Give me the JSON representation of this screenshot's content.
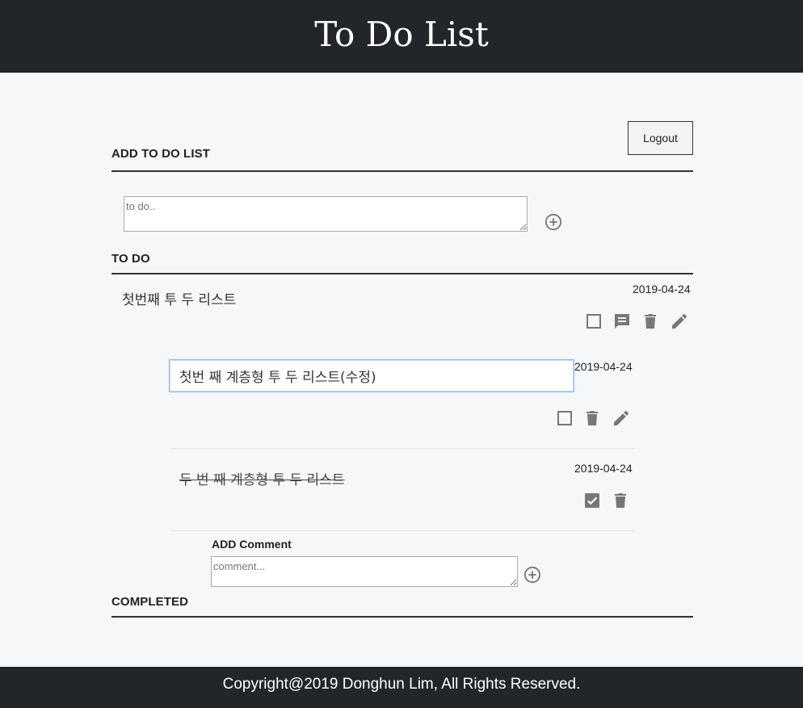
{
  "header": {
    "title": "To Do List"
  },
  "auth": {
    "logout_label": "Logout"
  },
  "add_section": {
    "title": "ADD TO DO LIST",
    "placeholder": "to do.."
  },
  "todo_section": {
    "title": "TO DO",
    "items": [
      {
        "text": "첫번째 투 두 리스트",
        "date": "2019-04-24",
        "completed": false,
        "children": [
          {
            "text": "첫번 째 계층형 투 두 리스트(수정)",
            "date": "2019-04-24",
            "completed": false,
            "editing": true
          },
          {
            "text": "두 번 째 계층형 투 두 리스트",
            "date": "2019-04-24",
            "completed": true,
            "editing": false
          }
        ]
      }
    ]
  },
  "comment": {
    "label": "ADD Comment",
    "placeholder": "comment..."
  },
  "completed_section": {
    "title": "COMPLETED"
  },
  "footer": {
    "text": "Copyright@2019 Donghun Lim, All Rights Reserved."
  },
  "icons": {
    "add": "add-circle-icon",
    "checkbox": "checkbox-icon",
    "checked": "checkbox-checked-icon",
    "comment": "comment-icon",
    "delete": "trash-icon",
    "edit": "pencil-icon"
  },
  "colors": {
    "header_bg": "#22262b",
    "page_bg": "#f6f7f9",
    "icon": "#777777",
    "focus_border": "#8fb3e6"
  }
}
